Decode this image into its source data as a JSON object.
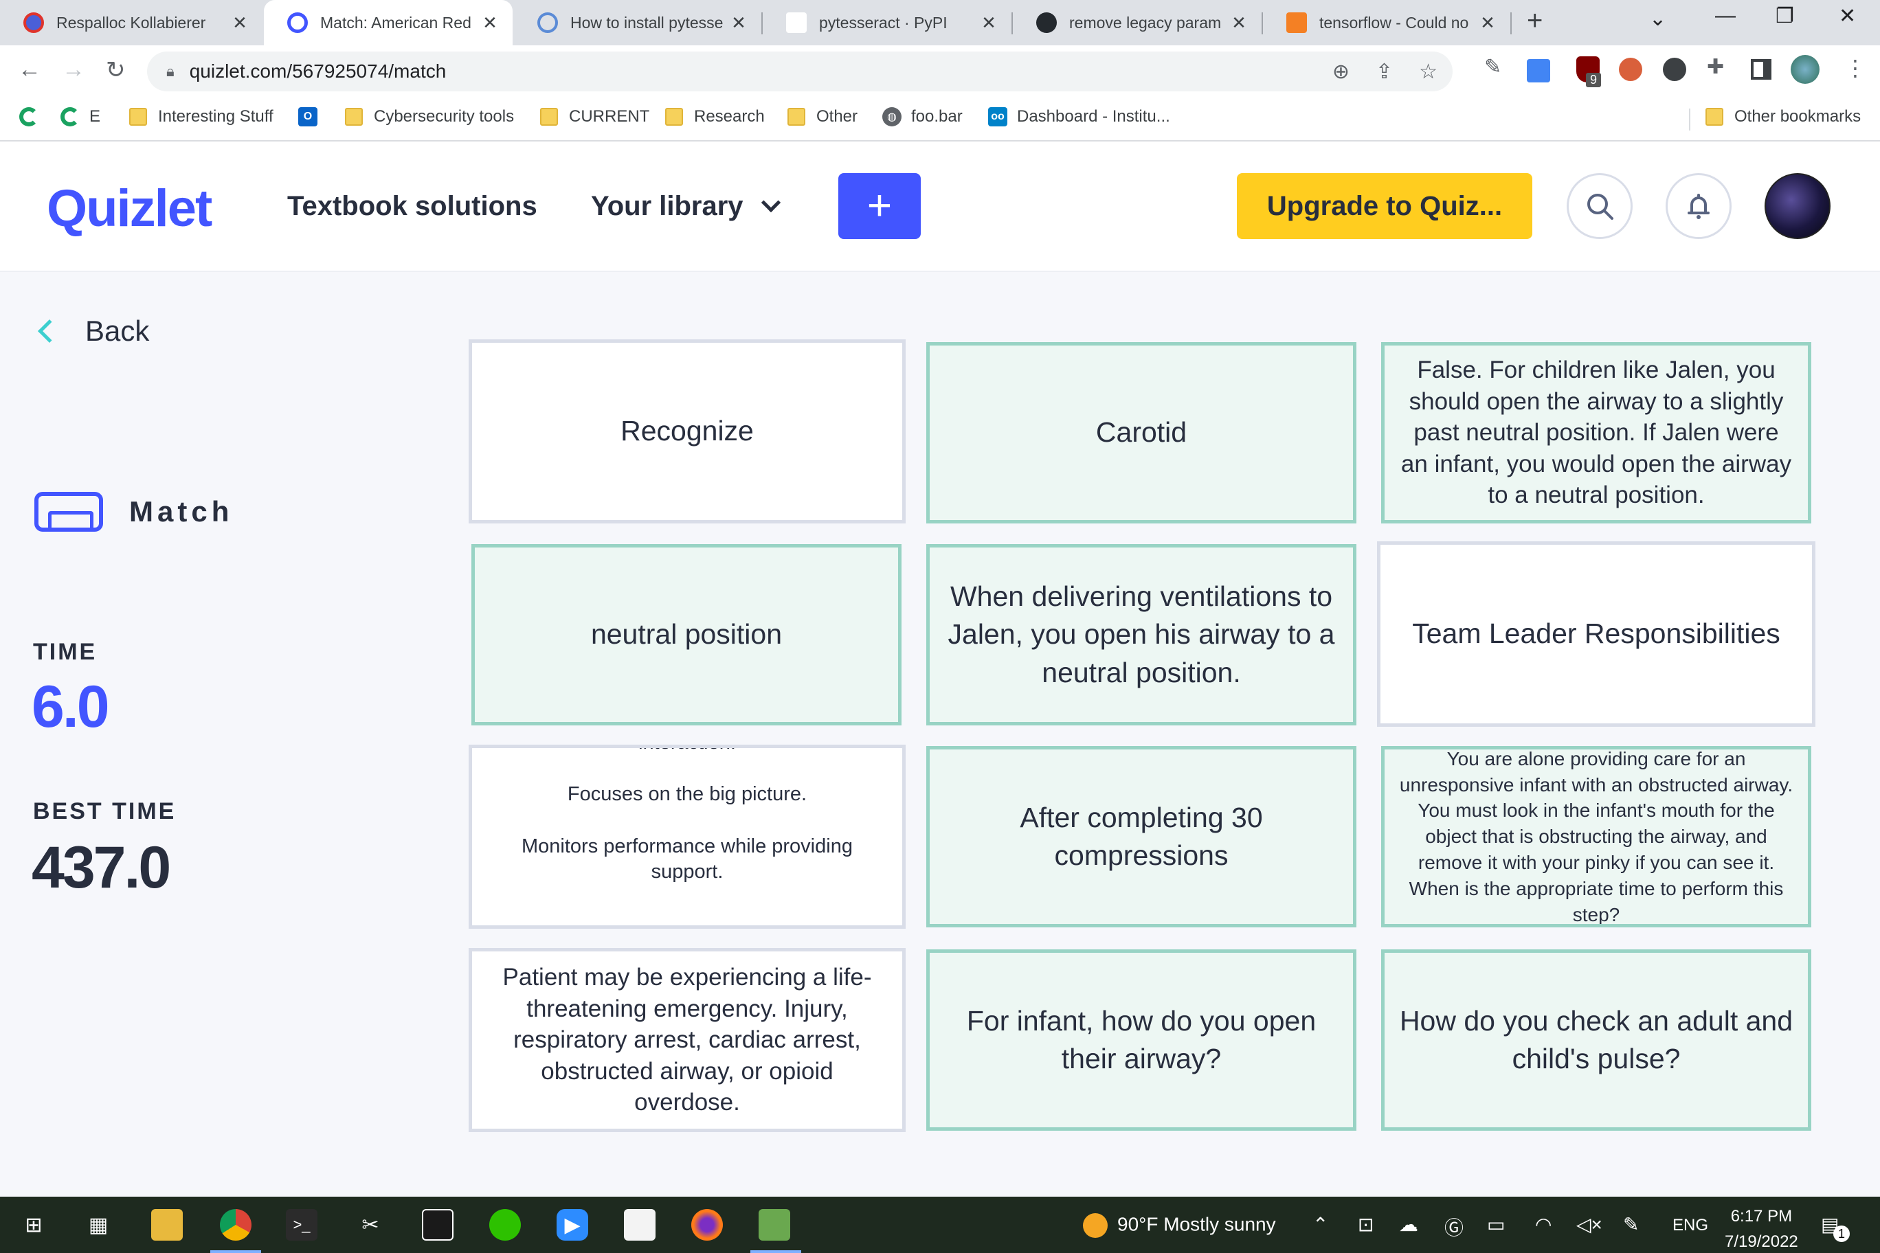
{
  "browser": {
    "tabs": [
      {
        "title": "Respalloc Kollabierer",
        "icon": "respalloc-icon"
      },
      {
        "title": "Match: American Red",
        "icon": "quizlet-icon",
        "active": true
      },
      {
        "title": "How to install pytesse",
        "icon": "gear-icon"
      },
      {
        "title": "pytesseract · PyPI",
        "icon": "pypi-icon"
      },
      {
        "title": "remove legacy param",
        "icon": "github-icon"
      },
      {
        "title": "tensorflow - Could no",
        "icon": "stackoverflow-icon"
      }
    ],
    "tab_close": "✕",
    "new_tab": "+",
    "url": "quizlet.com/567925074/match",
    "bookmarks": [
      {
        "label": "E",
        "icon": "c-icon"
      },
      {
        "label": "Interesting Stuff",
        "icon": "folder-icon"
      },
      {
        "label": "Cybersecurity tools",
        "icon": "folder-icon"
      },
      {
        "label": "CURRENT",
        "icon": "folder-icon"
      },
      {
        "label": "Research",
        "icon": "folder-icon"
      },
      {
        "label": "Other",
        "icon": "folder-icon"
      },
      {
        "label": "foo.bar",
        "icon": "globe-icon"
      },
      {
        "label": "Dashboard - Institu...",
        "icon": "nextcloud-icon"
      },
      {
        "label": "Other bookmarks",
        "icon": "folder-icon"
      }
    ],
    "extension_badge": "9"
  },
  "quizlet": {
    "logo": "Quizlet",
    "nav_textbook": "Textbook solutions",
    "nav_library": "Your library",
    "create_label": "+",
    "upgrade_label": "Upgrade to Quiz...",
    "brand_color": "#4255ff",
    "upgrade_color": "#ffcd1f"
  },
  "sidebar": {
    "back_label": "Back",
    "mode_label": "Match",
    "time_label": "TIME",
    "time_value": "6.0",
    "best_label": "BEST TIME",
    "best_value": "437.0"
  },
  "cards": [
    {
      "text": "Recognize",
      "selected": false
    },
    {
      "text": "Carotid",
      "selected": true
    },
    {
      "text": "False. For children like Jalen, you should open the airway to a slightly past neutral position. If Jalen were an infant, you would open the airway to a neutral position.",
      "selected": true
    },
    {
      "text": "neutral position",
      "selected": true
    },
    {
      "text": "When delivering ventilations to Jalen, you open his airway to a neutral position.",
      "selected": true
    },
    {
      "text": "Team Leader Responsibilities",
      "selected": false
    },
    {
      "text": "interaction.\n\nFocuses on the big picture.\n\nMonitors performance while providing support.",
      "selected": false
    },
    {
      "text": "After completing 30 compressions",
      "selected": true
    },
    {
      "text": "You are alone providing care for an unresponsive infant with an obstructed airway. You must look in the infant's mouth for the object that is obstructing the airway, and remove it with your pinky if you can see it. When is the appropriate time to perform this step?",
      "selected": true
    },
    {
      "text": "Patient may be experiencing a life-threatening emergency. Injury, respiratory arrest, cardiac arrest, obstructed airway, or opioid overdose.",
      "selected": false
    },
    {
      "text": "For infant, how do you open their airway?",
      "selected": true
    },
    {
      "text": "How do you check an adult and child's pulse?",
      "selected": true
    }
  ],
  "taskbar": {
    "weather": "90°F  Mostly sunny",
    "language": "ENG",
    "time": "6:17 PM",
    "date": "7/19/2022",
    "notification_count": "1"
  }
}
